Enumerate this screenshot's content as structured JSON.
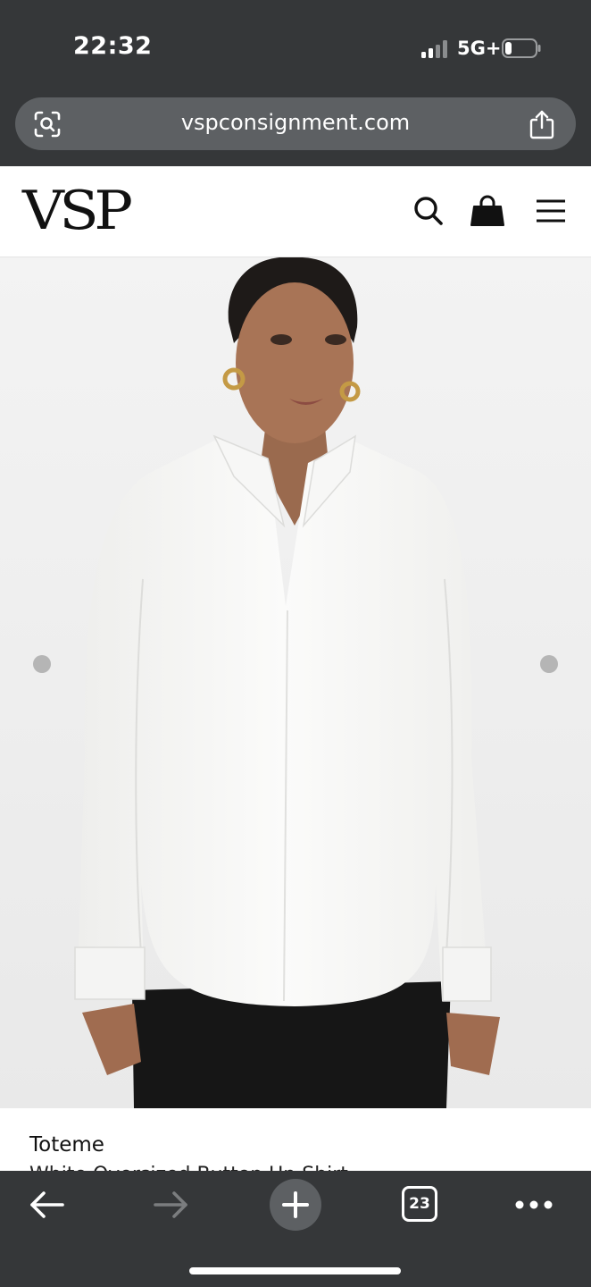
{
  "status_bar": {
    "time": "22:32",
    "network": "5G+",
    "signal_bars_active": 2,
    "signal_bars_total": 4,
    "battery_level": 0.15
  },
  "browser": {
    "url": "vspconsignment.com",
    "lens_icon": "camera-search-icon",
    "share_icon": "share-icon"
  },
  "site": {
    "logo": "VSP",
    "icons": [
      "search-icon",
      "shopping-bag-icon",
      "menu-icon"
    ]
  },
  "gallery": {
    "image_description": "model-wearing-white-oversized-shirt",
    "prev_icon": "carousel-prev-dot",
    "next_icon": "carousel-next-dot"
  },
  "product": {
    "brand": "Toteme",
    "name": "White Oversized Button Up Shirt"
  },
  "toolbar": {
    "tab_count": "23",
    "icons": [
      "back-arrow-icon",
      "forward-arrow-icon",
      "new-tab-icon",
      "tabs-icon",
      "more-icon"
    ]
  },
  "colors": {
    "chrome_bg": "#353739",
    "url_bar_bg": "#5d6063",
    "page_bg": "#ffffff",
    "photo_bg": "#efefef"
  }
}
